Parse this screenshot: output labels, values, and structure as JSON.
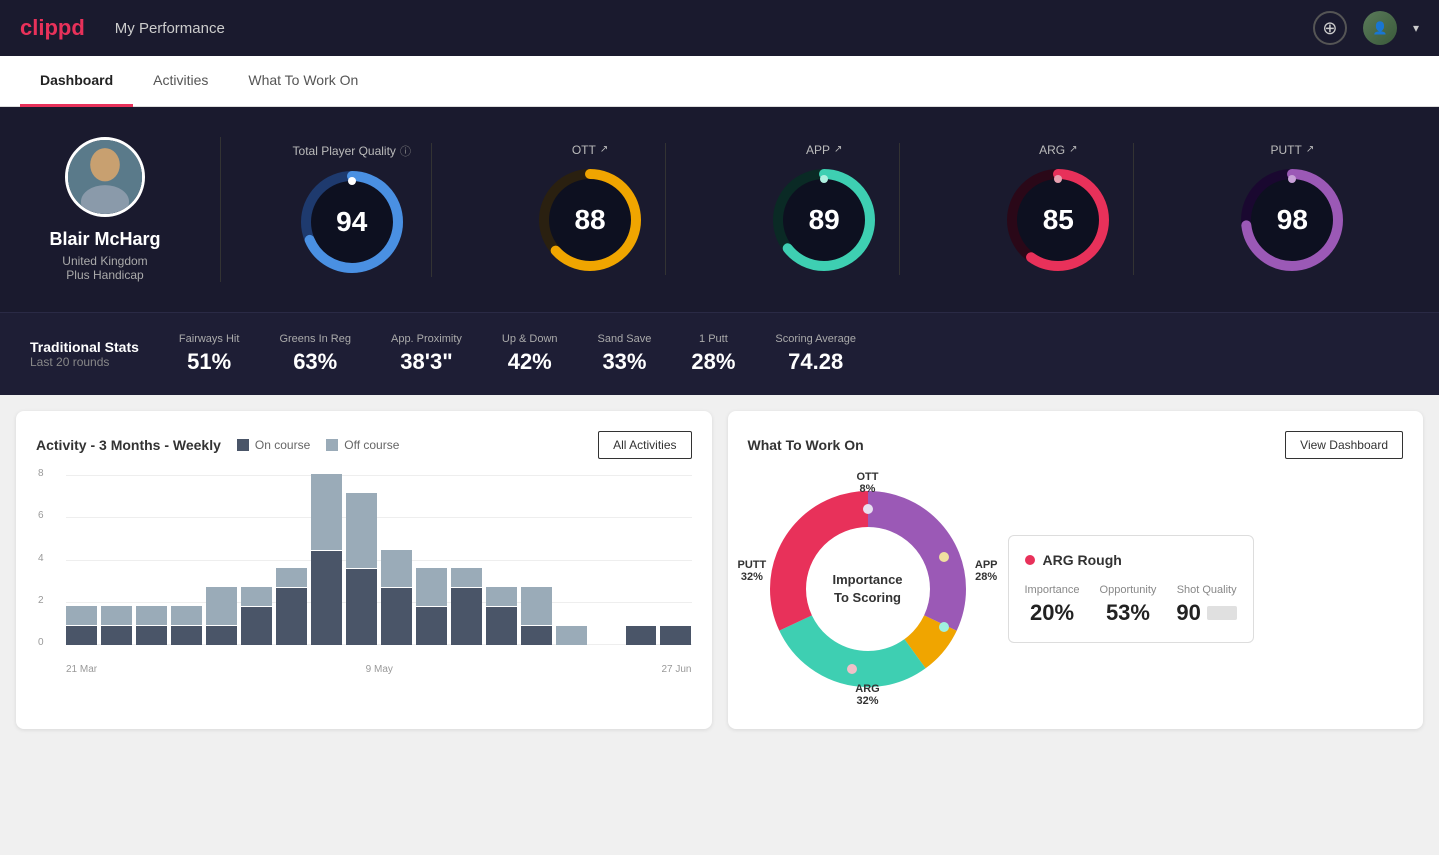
{
  "app": {
    "logo": "clippd",
    "nav_title": "My Performance"
  },
  "tabs": [
    {
      "id": "dashboard",
      "label": "Dashboard",
      "active": true
    },
    {
      "id": "activities",
      "label": "Activities",
      "active": false
    },
    {
      "id": "work-on",
      "label": "What To Work On",
      "active": false
    }
  ],
  "hero": {
    "player": {
      "name": "Blair McHarg",
      "country": "United Kingdom",
      "handicap": "Plus Handicap"
    },
    "total_quality_label": "Total Player Quality",
    "metrics": [
      {
        "id": "total",
        "value": "94",
        "color_start": "#4a90e2",
        "color_end": "#1e5fa8",
        "ring_color": "#4a90e2",
        "bg_color": "#1a1a2e",
        "label": null
      },
      {
        "id": "ott",
        "label": "OTT",
        "value": "88",
        "ring_color": "#f0a500",
        "trend": "↗"
      },
      {
        "id": "app",
        "label": "APP",
        "value": "89",
        "ring_color": "#3ecfb2",
        "trend": "↗"
      },
      {
        "id": "arg",
        "label": "ARG",
        "value": "85",
        "ring_color": "#e8315a",
        "trend": "↗"
      },
      {
        "id": "putt",
        "label": "PUTT",
        "value": "98",
        "ring_color": "#9b59b6",
        "trend": "↗"
      }
    ]
  },
  "trad_stats": {
    "title": "Traditional Stats",
    "help": "?",
    "subtitle": "Last 20 rounds",
    "stats": [
      {
        "label": "Fairways Hit",
        "value": "51%"
      },
      {
        "label": "Greens In Reg",
        "value": "63%"
      },
      {
        "label": "App. Proximity",
        "value": "38'3\""
      },
      {
        "label": "Up & Down",
        "value": "42%"
      },
      {
        "label": "Sand Save",
        "value": "33%"
      },
      {
        "label": "1 Putt",
        "value": "28%"
      },
      {
        "label": "Scoring Average",
        "value": "74.28"
      }
    ]
  },
  "activity_chart": {
    "title": "Activity - 3 Months - Weekly",
    "legend": [
      {
        "label": "On course",
        "color": "#4a5568"
      },
      {
        "label": "Off course",
        "color": "#9aabb8"
      }
    ],
    "all_activities_btn": "All Activities",
    "x_labels": [
      "21 Mar",
      "9 May",
      "27 Jun"
    ],
    "y_labels": [
      "8",
      "6",
      "4",
      "2",
      "0"
    ],
    "bars": [
      {
        "on": 1,
        "off": 1
      },
      {
        "on": 1,
        "off": 1
      },
      {
        "on": 1,
        "off": 1
      },
      {
        "on": 1,
        "off": 1
      },
      {
        "on": 1,
        "off": 2
      },
      {
        "on": 2,
        "off": 1
      },
      {
        "on": 3,
        "off": 1
      },
      {
        "on": 5,
        "off": 4
      },
      {
        "on": 4,
        "off": 4
      },
      {
        "on": 3,
        "off": 2
      },
      {
        "on": 2,
        "off": 2
      },
      {
        "on": 3,
        "off": 1
      },
      {
        "on": 2,
        "off": 1
      },
      {
        "on": 1,
        "off": 2
      },
      {
        "on": 0,
        "off": 1
      },
      {
        "on": 0,
        "off": 0
      },
      {
        "on": 1,
        "off": 0
      },
      {
        "on": 1,
        "off": 0
      }
    ]
  },
  "work_on": {
    "title": "What To Work On",
    "view_dashboard_btn": "View Dashboard",
    "donut_center": "Importance\nTo Scoring",
    "segments": [
      {
        "label": "OTT",
        "value": "8%",
        "color": "#f0a500"
      },
      {
        "label": "APP",
        "value": "28%",
        "color": "#3ecfb2"
      },
      {
        "label": "ARG",
        "value": "32%",
        "color": "#e8315a"
      },
      {
        "label": "PUTT",
        "value": "32%",
        "color": "#9b59b6"
      }
    ],
    "info_card": {
      "title": "ARG Rough",
      "dot_color": "#e8315a",
      "metrics": [
        {
          "label": "Importance",
          "value": "20%"
        },
        {
          "label": "Opportunity",
          "value": "53%"
        },
        {
          "label": "Shot Quality",
          "value": "90"
        }
      ]
    }
  }
}
